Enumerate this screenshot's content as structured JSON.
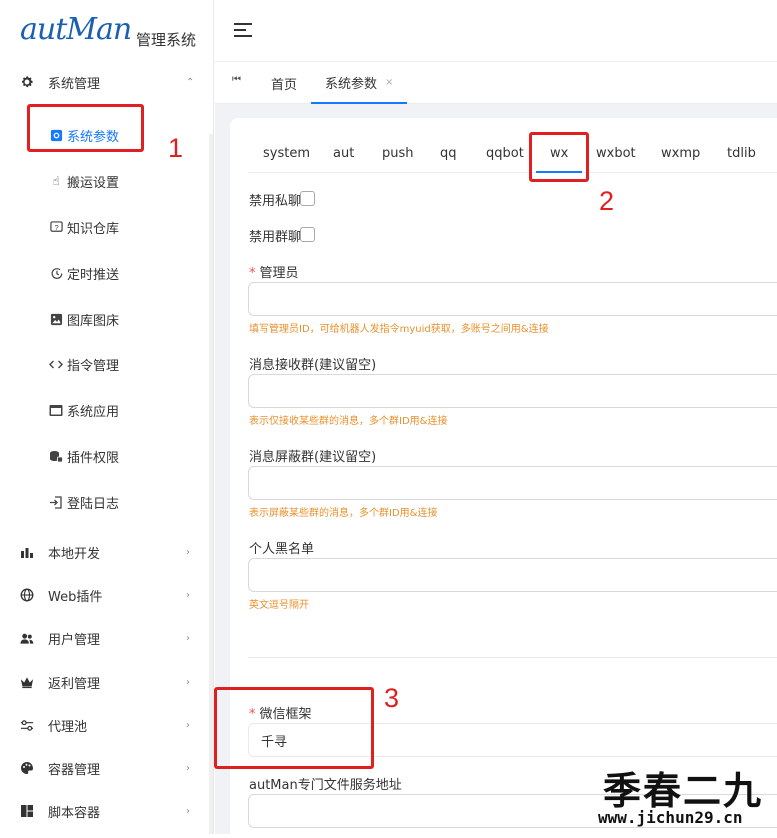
{
  "logo": {
    "script": "autMan",
    "subtitle": "管理系统"
  },
  "sidebar": {
    "system_group": {
      "label": "系统管理",
      "icon": "gear-icon"
    },
    "sub_items": [
      {
        "label": "系统参数",
        "icon": "settings-square-icon",
        "active": true
      },
      {
        "label": "搬运设置",
        "icon": "hand-pointer-icon"
      },
      {
        "label": "知识仓库",
        "icon": "question-box-icon"
      },
      {
        "label": "定时推送",
        "icon": "clock-icon"
      },
      {
        "label": "图库图床",
        "icon": "image-icon"
      },
      {
        "label": "指令管理",
        "icon": "code-icon"
      },
      {
        "label": "系统应用",
        "icon": "window-icon"
      },
      {
        "label": "插件权限",
        "icon": "database-lock-icon"
      },
      {
        "label": "登陆日志",
        "icon": "login-icon"
      }
    ],
    "groups": [
      {
        "label": "本地开发",
        "icon": "bar-chart-icon"
      },
      {
        "label": "Web插件",
        "icon": "globe-icon"
      },
      {
        "label": "用户管理",
        "icon": "users-icon"
      },
      {
        "label": "返利管理",
        "icon": "crown-icon"
      },
      {
        "label": "代理池",
        "icon": "sliders-icon"
      },
      {
        "label": "容器管理",
        "icon": "palette-icon"
      },
      {
        "label": "脚本容器",
        "icon": "grid-icon"
      }
    ]
  },
  "tabbar": {
    "home": "首页",
    "current": "系统参数",
    "close": "×"
  },
  "inner_tabs": [
    "system",
    "aut",
    "push",
    "qq",
    "qqbot",
    "wx",
    "wxbot",
    "wxmp",
    "tdlib"
  ],
  "active_inner_tab": "wx",
  "form": {
    "disable_private": "禁用私聊",
    "disable_group": "禁用群聊",
    "admin_label": "管理员",
    "admin_hint": "填写管理员ID，可给机器人发指令myuid获取，多账号之间用&连接",
    "msg_recv_label": "消息接收群(建议留空)",
    "msg_recv_hint": "表示仅接收某些群的消息，多个群ID用&连接",
    "msg_block_label": "消息屏蔽群(建议留空)",
    "msg_block_hint": "表示屏蔽某些群的消息，多个群ID用&连接",
    "blacklist_label": "个人黑名单",
    "blacklist_hint": "英文逗号隔开",
    "framework_label": "微信框架",
    "framework_value": "千寻",
    "file_service_label": "autMan专门文件服务地址"
  },
  "annotations": [
    "1",
    "2",
    "3"
  ],
  "watermark": {
    "big": "季春二九",
    "small": "www.jichun29.cn"
  },
  "colors": {
    "accent": "#1677ff",
    "annotation": "#e02020",
    "hint": "#e8912d",
    "required": "#ff4d4f"
  }
}
